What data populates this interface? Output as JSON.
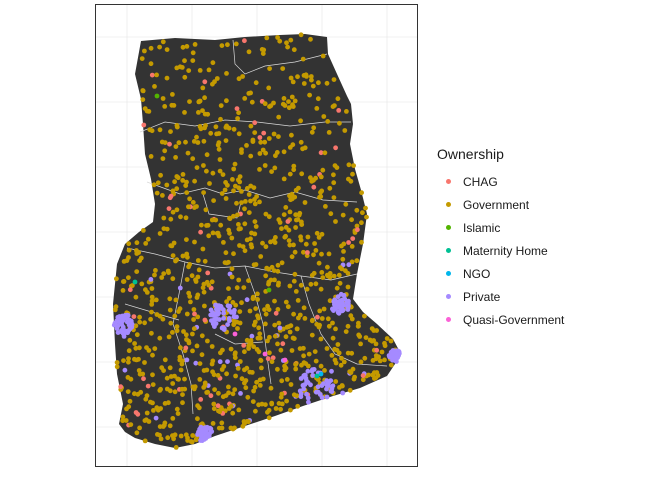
{
  "legend": {
    "title": "Ownership",
    "items": [
      {
        "label": "CHAG",
        "color": "#f8766d"
      },
      {
        "label": "Government",
        "color": "#c49a00"
      },
      {
        "label": "Islamic",
        "color": "#53b400"
      },
      {
        "label": "Maternity Home",
        "color": "#00c094"
      },
      {
        "label": "NGO",
        "color": "#00b6eb"
      },
      {
        "label": "Private",
        "color": "#a58aff"
      },
      {
        "label": "Quasi-Government",
        "color": "#fb61d7"
      }
    ]
  },
  "colors": {
    "land": "#333333",
    "boundary": "#d9d9d9",
    "grid": "#ebebeb",
    "panel_border": "#333333"
  }
}
